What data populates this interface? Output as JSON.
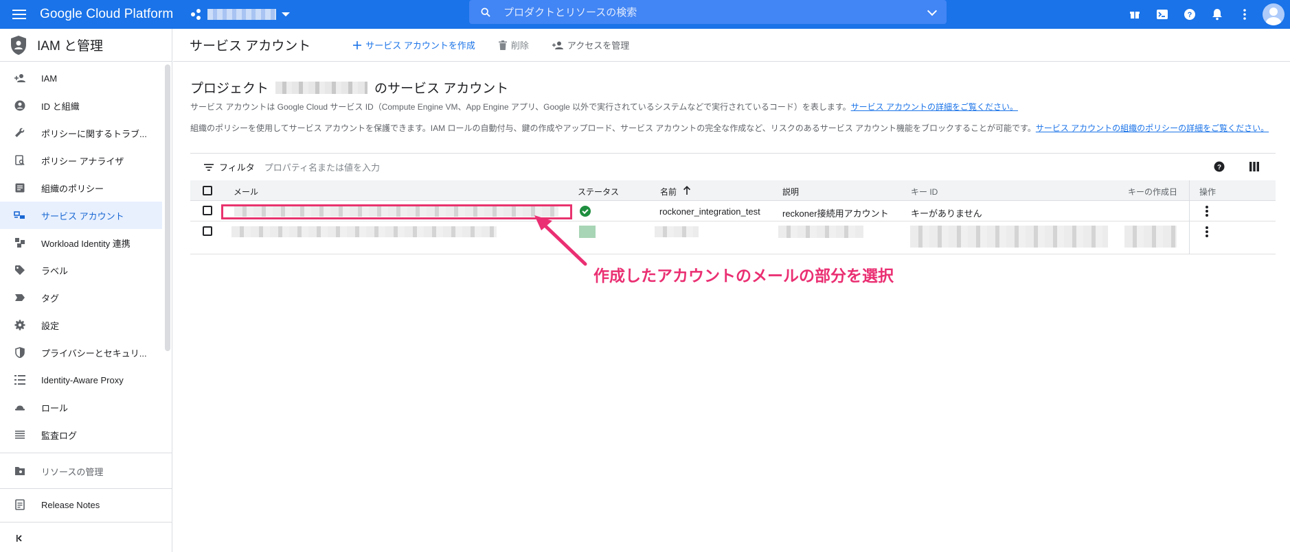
{
  "topbar": {
    "brand": "Google Cloud Platform",
    "search_placeholder": "プロダクトとリソースの検索"
  },
  "sidebar": {
    "title": "IAM と管理",
    "items": [
      {
        "label": "IAM",
        "icon": "person-add-icon"
      },
      {
        "label": "ID と組織",
        "icon": "account-circle-icon"
      },
      {
        "label": "ポリシーに関するトラブ...",
        "icon": "wrench-icon"
      },
      {
        "label": "ポリシー アナライザ",
        "icon": "policy-analyzer-icon"
      },
      {
        "label": "組織のポリシー",
        "icon": "article-icon"
      },
      {
        "label": "サービス アカウント",
        "icon": "service-account-icon",
        "active": true
      },
      {
        "label": "Workload Identity 連携",
        "icon": "workload-identity-icon"
      },
      {
        "label": "ラベル",
        "icon": "label-icon"
      },
      {
        "label": "タグ",
        "icon": "tag-icon"
      },
      {
        "label": "設定",
        "icon": "gear-icon"
      },
      {
        "label": "プライバシーとセキュリ...",
        "icon": "privacy-shield-icon"
      },
      {
        "label": "Identity-Aware Proxy",
        "icon": "iap-icon"
      },
      {
        "label": "ロール",
        "icon": "role-hat-icon"
      },
      {
        "label": "監査ログ",
        "icon": "list-icon"
      }
    ],
    "bottom": {
      "resource_manager": "リソースの管理",
      "release_notes": "Release Notes"
    }
  },
  "header": {
    "title": "サービス アカウント",
    "create": "サービス アカウントを作成",
    "delete": "削除",
    "manage_access": "アクセスを管理"
  },
  "content": {
    "title_prefix": "プロジェクト",
    "title_suffix": "のサービス アカウント",
    "desc1": "サービス アカウントは Google Cloud サービス ID（Compute Engine VM、App Engine アプリ、Google 以外で実行されているシステムなどで実行されているコード）を表します。",
    "desc1_link": "サービス アカウントの詳細をご覧ください。",
    "desc2": "組織のポリシーを使用してサービス アカウントを保護できます。IAM ロールの自動付与、鍵の作成やアップロード、サービス アカウントの完全な作成など、リスクのあるサービス アカウント機能をブロックすることが可能です。",
    "desc2_link": "サービス アカウントの組織のポリシーの詳細をご覧ください。"
  },
  "table": {
    "filter_label": "フィルタ",
    "filter_placeholder": "プロパティ名または値を入力",
    "headers": {
      "email": "メール",
      "status": "ステータス",
      "name": "名前",
      "description": "説明",
      "key_id": "キー ID",
      "key_created": "キーの作成日",
      "actions": "操作"
    },
    "rows": [
      {
        "name": "rockoner_integration_test",
        "description": "reckoner接続用アカウント",
        "key_id": "キーがありません",
        "status": "enabled"
      }
    ]
  },
  "annotation": {
    "text": "作成したアカウントのメールの部分を選択"
  },
  "colors": {
    "brand_blue": "#1a73e8",
    "annotation_pink": "#ea2f72",
    "status_green": "#1e8e3e"
  }
}
